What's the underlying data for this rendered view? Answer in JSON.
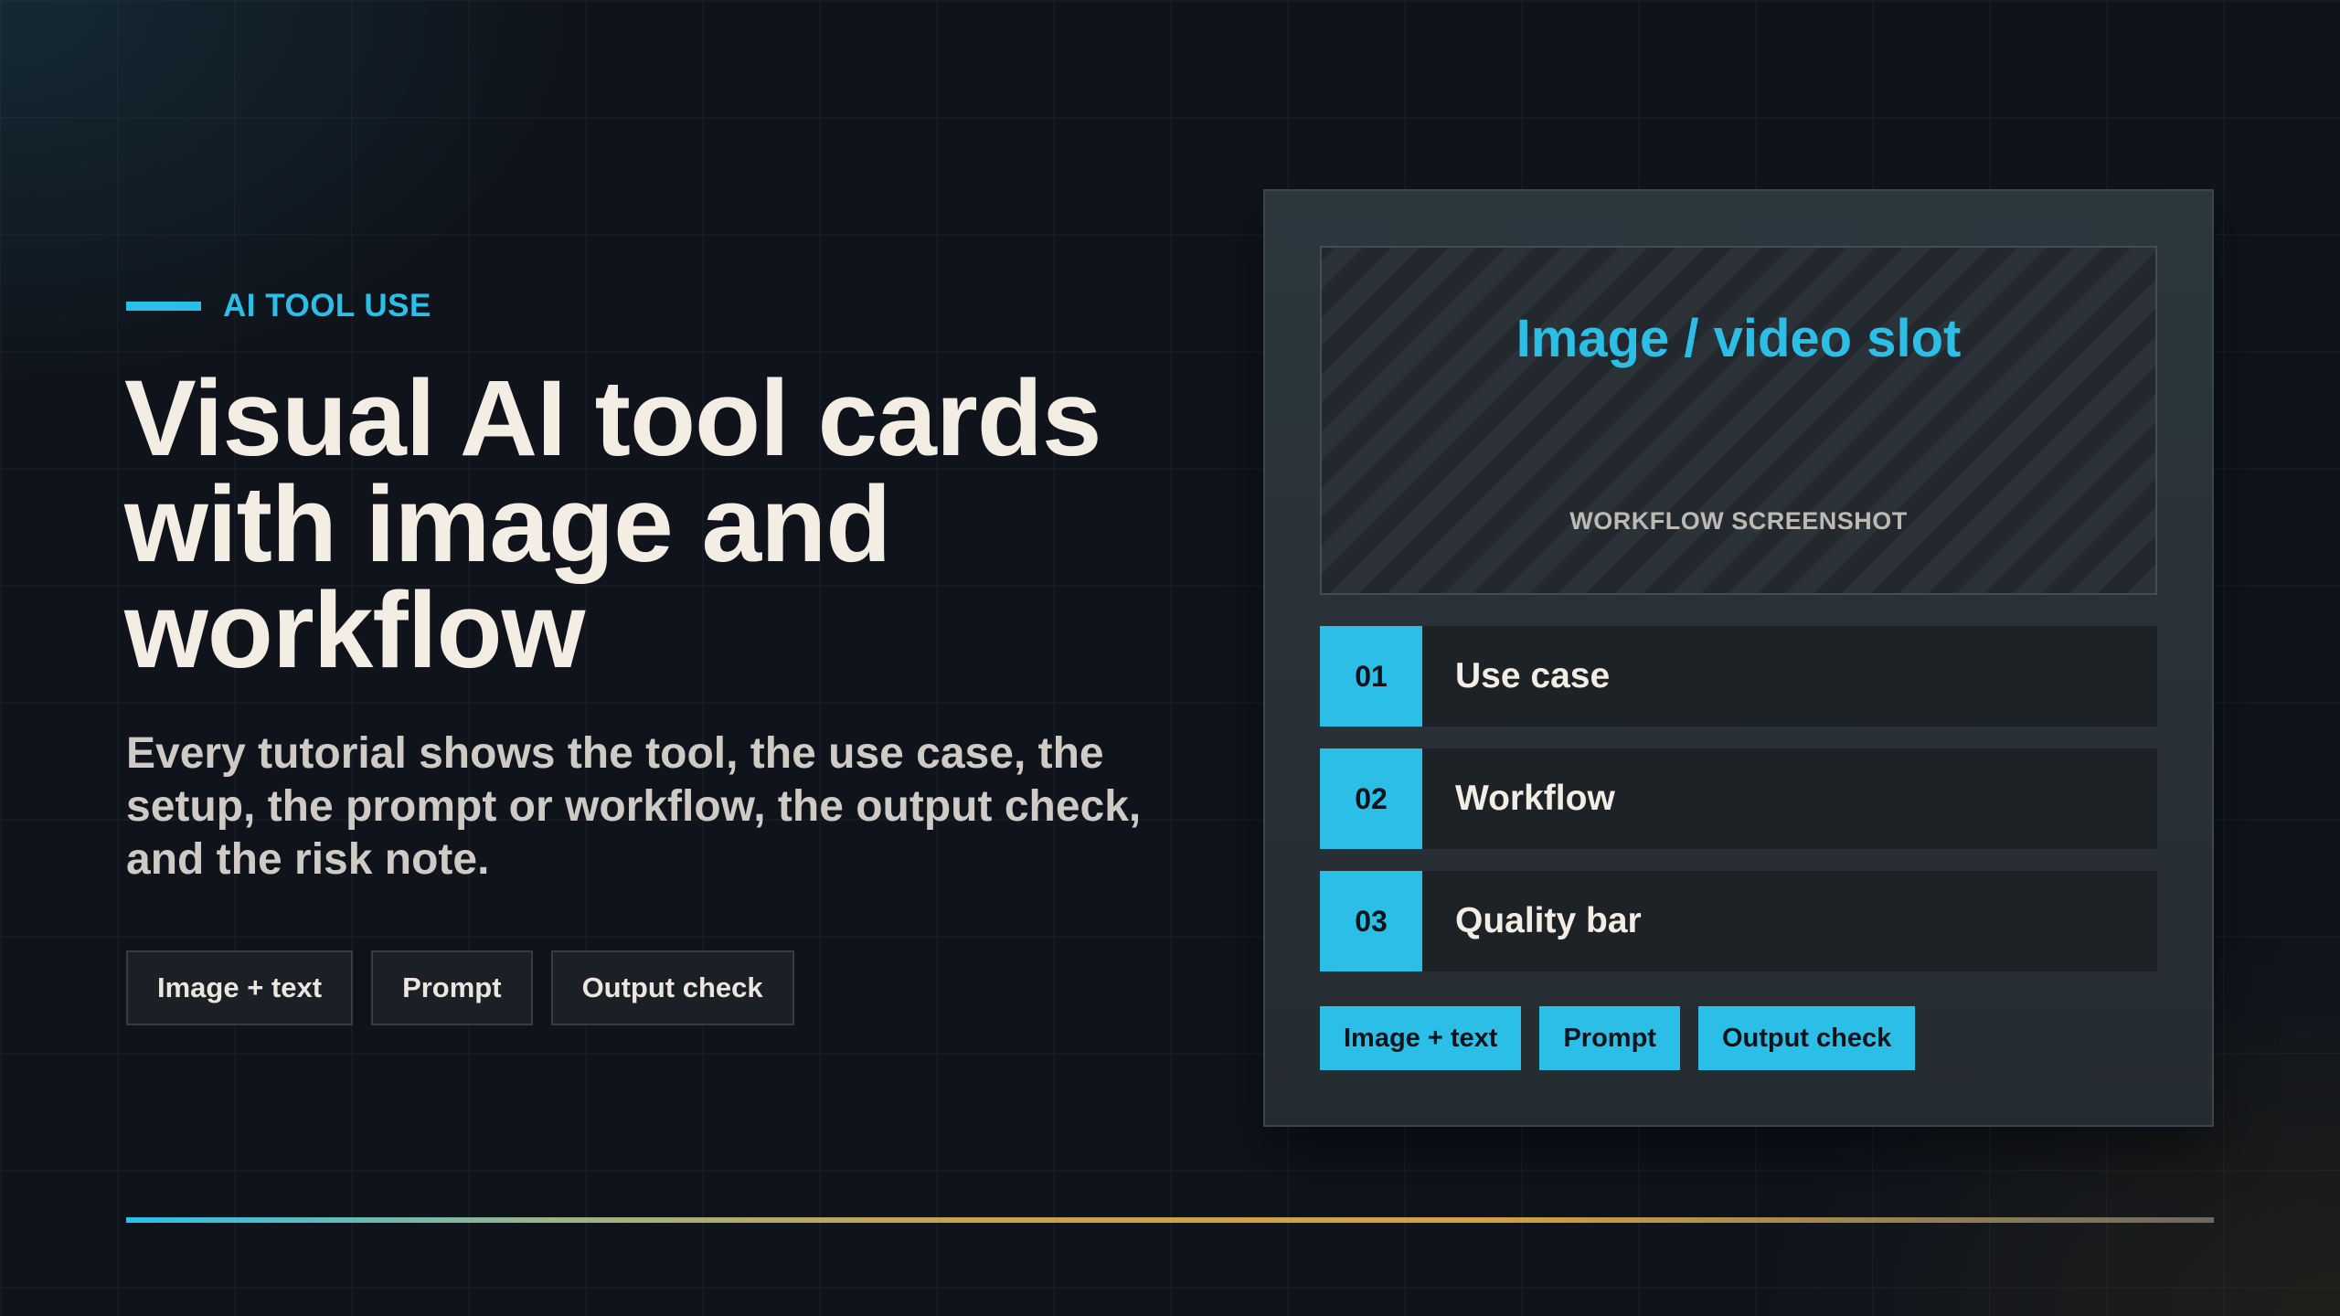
{
  "hero": {
    "eyebrow": "AI TOOL USE",
    "headline": "Visual AI tool cards with image and workflow",
    "subtext": "Every tutorial shows the tool, the use case, the setup, the prompt or workflow, the output check, and the risk note.",
    "tags": [
      "Image + text",
      "Prompt",
      "Output check"
    ]
  },
  "card": {
    "media": {
      "title": "Image / video slot",
      "caption": "WORKFLOW SCREENSHOT"
    },
    "steps": [
      {
        "number": "01",
        "label": "Use case"
      },
      {
        "number": "02",
        "label": "Workflow"
      },
      {
        "number": "03",
        "label": "Quality bar"
      }
    ],
    "tags": [
      "Image + text",
      "Prompt",
      "Output check"
    ]
  },
  "colors": {
    "accent": "#2bbfe8",
    "background": "#0f141c",
    "headline": "#f3ede3",
    "rule_end": "#d4a140"
  }
}
